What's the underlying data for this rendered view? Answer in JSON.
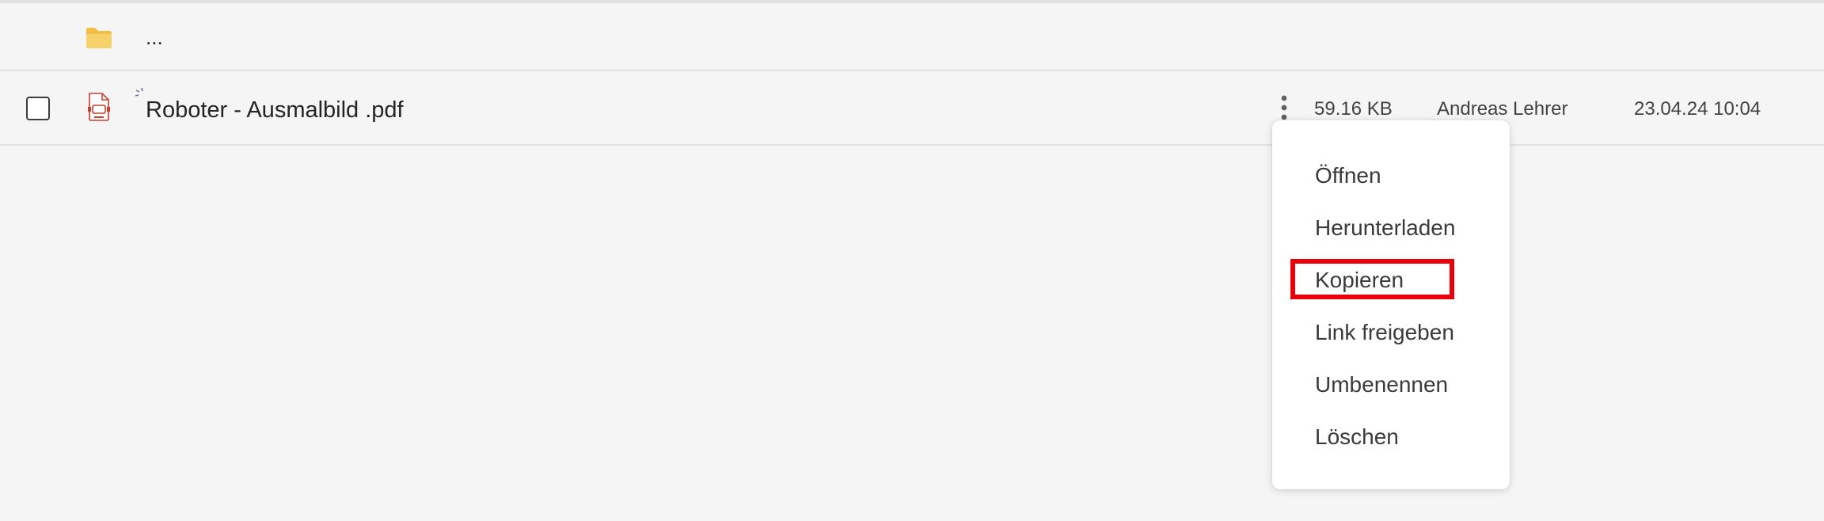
{
  "parent_row": {
    "icon": "folder-icon",
    "label": "..."
  },
  "file_row": {
    "file_icon": "pdf-file-icon",
    "status_icon": "sync-spinner-icon",
    "name": "Roboter - Ausmalbild .pdf",
    "size": "59.16 KB",
    "owner": "Andreas Lehrer",
    "modified": "23.04.24 10:04",
    "more_icon": "more-vertical-icon"
  },
  "context_menu": {
    "items": [
      {
        "label": "Öffnen"
      },
      {
        "label": "Herunterladen"
      },
      {
        "label": "Kopieren",
        "highlighted": true
      },
      {
        "label": "Link freigeben"
      },
      {
        "label": "Umbenennen"
      },
      {
        "label": "Löschen"
      }
    ]
  },
  "colors": {
    "background": "#f5f5f5",
    "menu_background": "#ffffff",
    "highlight": "#e8000b",
    "folder": "#f4c64f",
    "pdf": "#c4402f"
  }
}
